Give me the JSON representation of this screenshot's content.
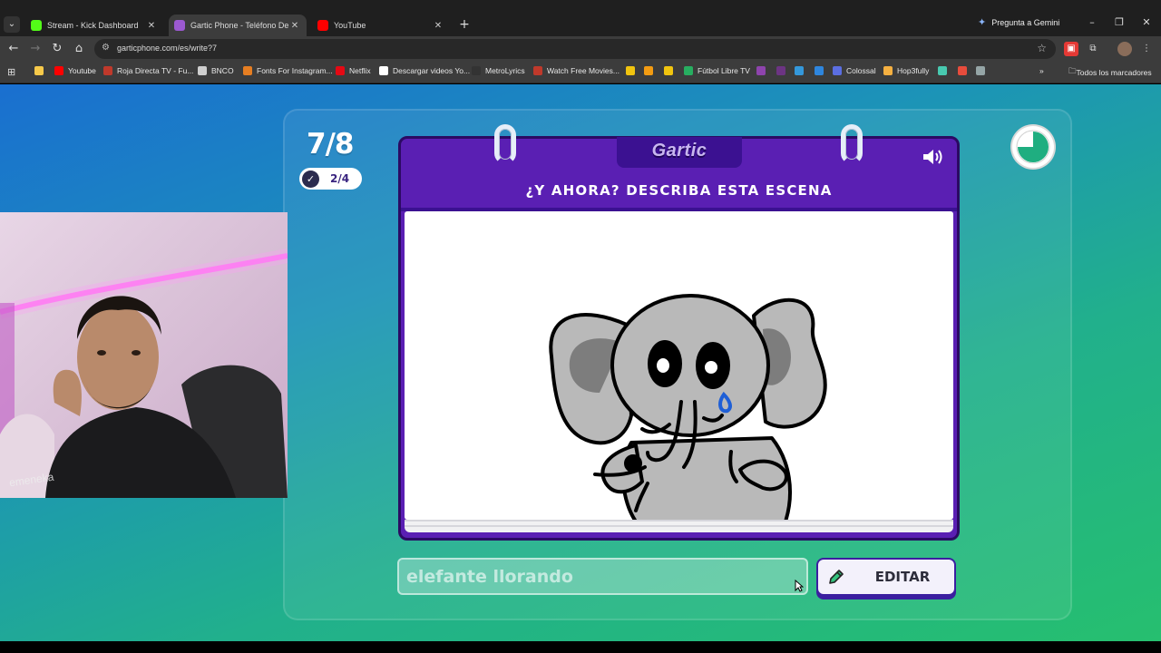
{
  "browser": {
    "tabs": [
      {
        "title": "Stream - Kick Dashboard",
        "icon": "kick-icon",
        "color": "#53fc18",
        "active": false
      },
      {
        "title": "Gartic Phone - Teléfono Descon",
        "icon": "gartic-icon",
        "color": "#9b59d0",
        "active": true
      },
      {
        "title": "YouTube",
        "icon": "youtube-icon",
        "color": "#ff0000",
        "active": false
      }
    ],
    "gemini_label": "Pregunta a Gemini",
    "url": "garticphone.com/es/write?7",
    "bookmarks": [
      {
        "label": "",
        "color": "#f6c94a"
      },
      {
        "label": "Youtube",
        "color": "#ff0000"
      },
      {
        "label": "Roja Directa TV - Fu...",
        "color": "#c0392b"
      },
      {
        "label": "BNCO",
        "color": "#cfcfcf"
      },
      {
        "label": "Fonts For Instagram...",
        "color": "#e67e22"
      },
      {
        "label": "Netflix",
        "color": "#e50914"
      },
      {
        "label": "Descargar videos Yo...",
        "color": "#ffffff"
      },
      {
        "label": "MetroLyrics",
        "color": "#333333"
      },
      {
        "label": "Watch Free Movies...",
        "color": "#c0392b"
      },
      {
        "label": "",
        "color": "#f1c40f"
      },
      {
        "label": "",
        "color": "#f39c12"
      },
      {
        "label": "",
        "color": "#f1c40f"
      },
      {
        "label": "Fútbol Libre TV",
        "color": "#27ae60"
      },
      {
        "label": "",
        "color": "#8e44ad"
      },
      {
        "label": "",
        "color": "#6c3483"
      },
      {
        "label": "",
        "color": "#3498db"
      },
      {
        "label": "",
        "color": "#2e86de"
      },
      {
        "label": "Colossal",
        "color": "#5b6ee1"
      },
      {
        "label": "Hop3fully",
        "color": "#f5b041"
      },
      {
        "label": "",
        "color": "#48c9b0"
      },
      {
        "label": "",
        "color": "#e74c3c"
      },
      {
        "label": "",
        "color": "#95a5a6"
      }
    ],
    "all_bookmarks_label": "Todos los marcadores"
  },
  "game": {
    "round": "7/8",
    "done_count": "2/4",
    "logo": "Gartic",
    "prompt": "¿Y AHORA? DESCRIBA ESTA ESCENA",
    "answer_value": "elefante llorando",
    "edit_label": "EDITAR",
    "timer_elapsed_fraction": 0.75,
    "colors": {
      "board": "#5a1fb3",
      "board_dark": "#3b1191",
      "tear": "#1f5fd6",
      "elephant": "#b9b9b9"
    }
  },
  "webcam": {
    "hoodie_text": "emeneka"
  }
}
